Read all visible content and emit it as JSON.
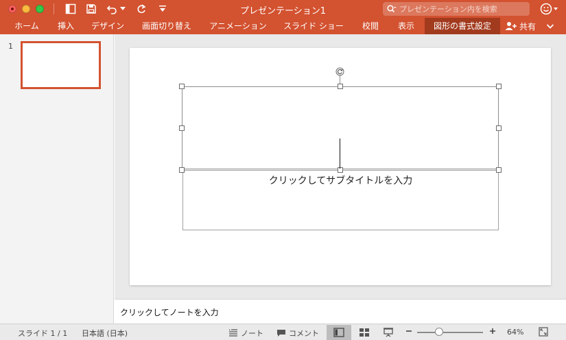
{
  "window": {
    "title": "プレゼンテーション1",
    "search_placeholder": "プレゼンテーション内を検索",
    "accent_color": "#d35230"
  },
  "quick_access": {
    "icons": [
      "sidebar-toggle-icon",
      "save-icon",
      "undo-icon",
      "undo-dropdown-icon",
      "redo-icon",
      "customize-icon"
    ]
  },
  "ribbon": {
    "tabs": [
      {
        "label": "ホーム"
      },
      {
        "label": "挿入"
      },
      {
        "label": "デザイン"
      },
      {
        "label": "画面切り替え"
      },
      {
        "label": "アニメーション"
      },
      {
        "label": "スライド ショー"
      },
      {
        "label": "校閲"
      },
      {
        "label": "表示"
      },
      {
        "label": "図形の書式設定",
        "active": true
      }
    ],
    "share_label": "共有"
  },
  "thumbnails": {
    "slides": [
      {
        "number": "1",
        "selected": true
      }
    ]
  },
  "slide": {
    "subtitle_placeholder": "クリックしてサブタイトルを入力"
  },
  "notes": {
    "placeholder": "クリックしてノートを入力"
  },
  "statusbar": {
    "slide_position": "スライド 1 / 1",
    "language": "日本語 (日本)",
    "notes_label": "ノート",
    "comments_label": "コメント",
    "zoom_level": "64%",
    "zoom_fraction": 0.64
  }
}
